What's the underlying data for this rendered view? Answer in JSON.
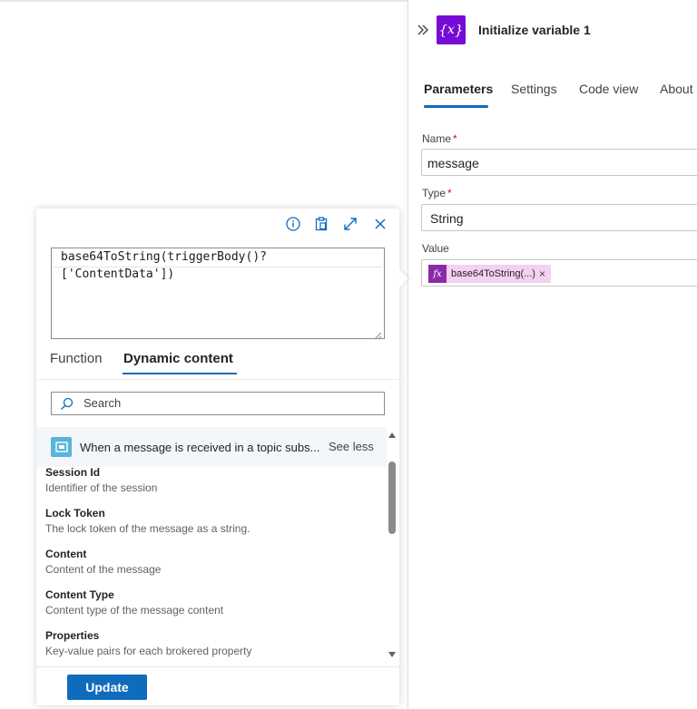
{
  "panel": {
    "title": "Initialize variable 1",
    "tabs": [
      "Parameters",
      "Settings",
      "Code view",
      "About"
    ],
    "fields": {
      "name": {
        "label": "Name",
        "required_mark": "*",
        "value": "message"
      },
      "type": {
        "label": "Type",
        "required_mark": "*",
        "value": "String"
      },
      "value": {
        "label": "Value",
        "token_text": "base64ToString(...)",
        "token_remove": "×"
      }
    }
  },
  "editor": {
    "line1": "base64ToString(triggerBody()?",
    "line2": "['ContentData'])"
  },
  "popup_tabs": [
    "Function",
    "Dynamic content"
  ],
  "search": {
    "placeholder": "Search"
  },
  "dynamic_content": {
    "group_title": "When a message is received in a topic subs...",
    "see_less": "See less",
    "items": [
      {
        "name": "Session Id",
        "description": "Identifier of the session"
      },
      {
        "name": "Lock Token",
        "description": "The lock token of the message as a string."
      },
      {
        "name": "Content",
        "description": "Content of the message"
      },
      {
        "name": "Content Type",
        "description": "Content type of the message content"
      },
      {
        "name": "Properties",
        "description": "Key-value pairs for each brokered property"
      }
    ]
  },
  "update_label": "Update",
  "colors": {
    "accent": "#0f6cbd",
    "variable_icon": "#770bd6",
    "token_bg": "#f3d1f1",
    "token_fx": "#8b2ba8",
    "service_bus_icon": "#59b4d9"
  },
  "icons": [
    "collapse-double-chevron-icon",
    "variable-icon",
    "info-icon",
    "clipboard-icon",
    "expand-icon",
    "close-icon",
    "search-icon",
    "service-bus-icon",
    "function-fx-icon"
  ]
}
